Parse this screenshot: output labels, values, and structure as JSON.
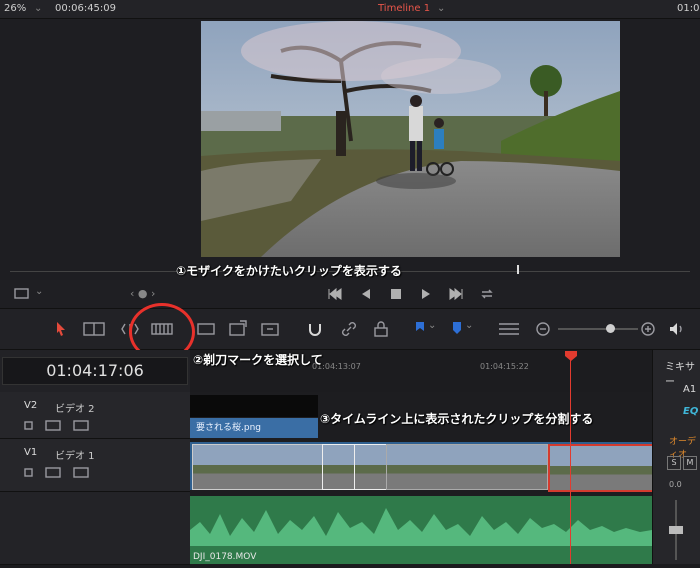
{
  "topbar": {
    "zoom": "26%",
    "timecode": "00:06:45:09",
    "timeline_name": "Timeline 1",
    "right_timecode": "01:0"
  },
  "annotations": {
    "step1": "①モザイクをかけたいクリップを表示する",
    "step2": "②剃刀マークを選択して",
    "step3": "③タイムライン上に表示されたクリップを分割する"
  },
  "timeline": {
    "timecode": "01:04:17:06",
    "ruler_ticks": [
      "01:04:13:07",
      "01:04:15:22"
    ],
    "tracks": [
      {
        "id": "V2",
        "name": "ビデオ 2"
      },
      {
        "id": "V1",
        "name": "ビデオ 1"
      }
    ],
    "v2_clip_label": "要される桜.png",
    "audio_clip_label": "DJI_0178.MOV"
  },
  "mixer": {
    "title": "ミキサー",
    "channel": "A1",
    "eq": "EQ",
    "ch_label": "オーディオ",
    "s": "S",
    "m": "M",
    "level": "0.0"
  },
  "colors": {
    "accent_red": "#e8312b",
    "clip_blue": "#2f5f8f",
    "audio_green": "#3e9a5e",
    "playhead": "#e23b2f"
  },
  "icons": [
    "dropdown-icon",
    "viewer-layout-icon",
    "first-frame-icon",
    "play-reverse-icon",
    "stop-icon",
    "play-icon",
    "last-frame-icon",
    "loop-icon",
    "select-arrow-icon",
    "trim-icon",
    "dynamic-trim-icon",
    "blade-icon",
    "insert-icon",
    "overwrite-icon",
    "replace-icon",
    "snapping-icon",
    "link-icon",
    "lock-icon",
    "flag-icon",
    "marker-icon",
    "zoom-out-icon",
    "zoom-in-icon",
    "speaker-icon"
  ]
}
